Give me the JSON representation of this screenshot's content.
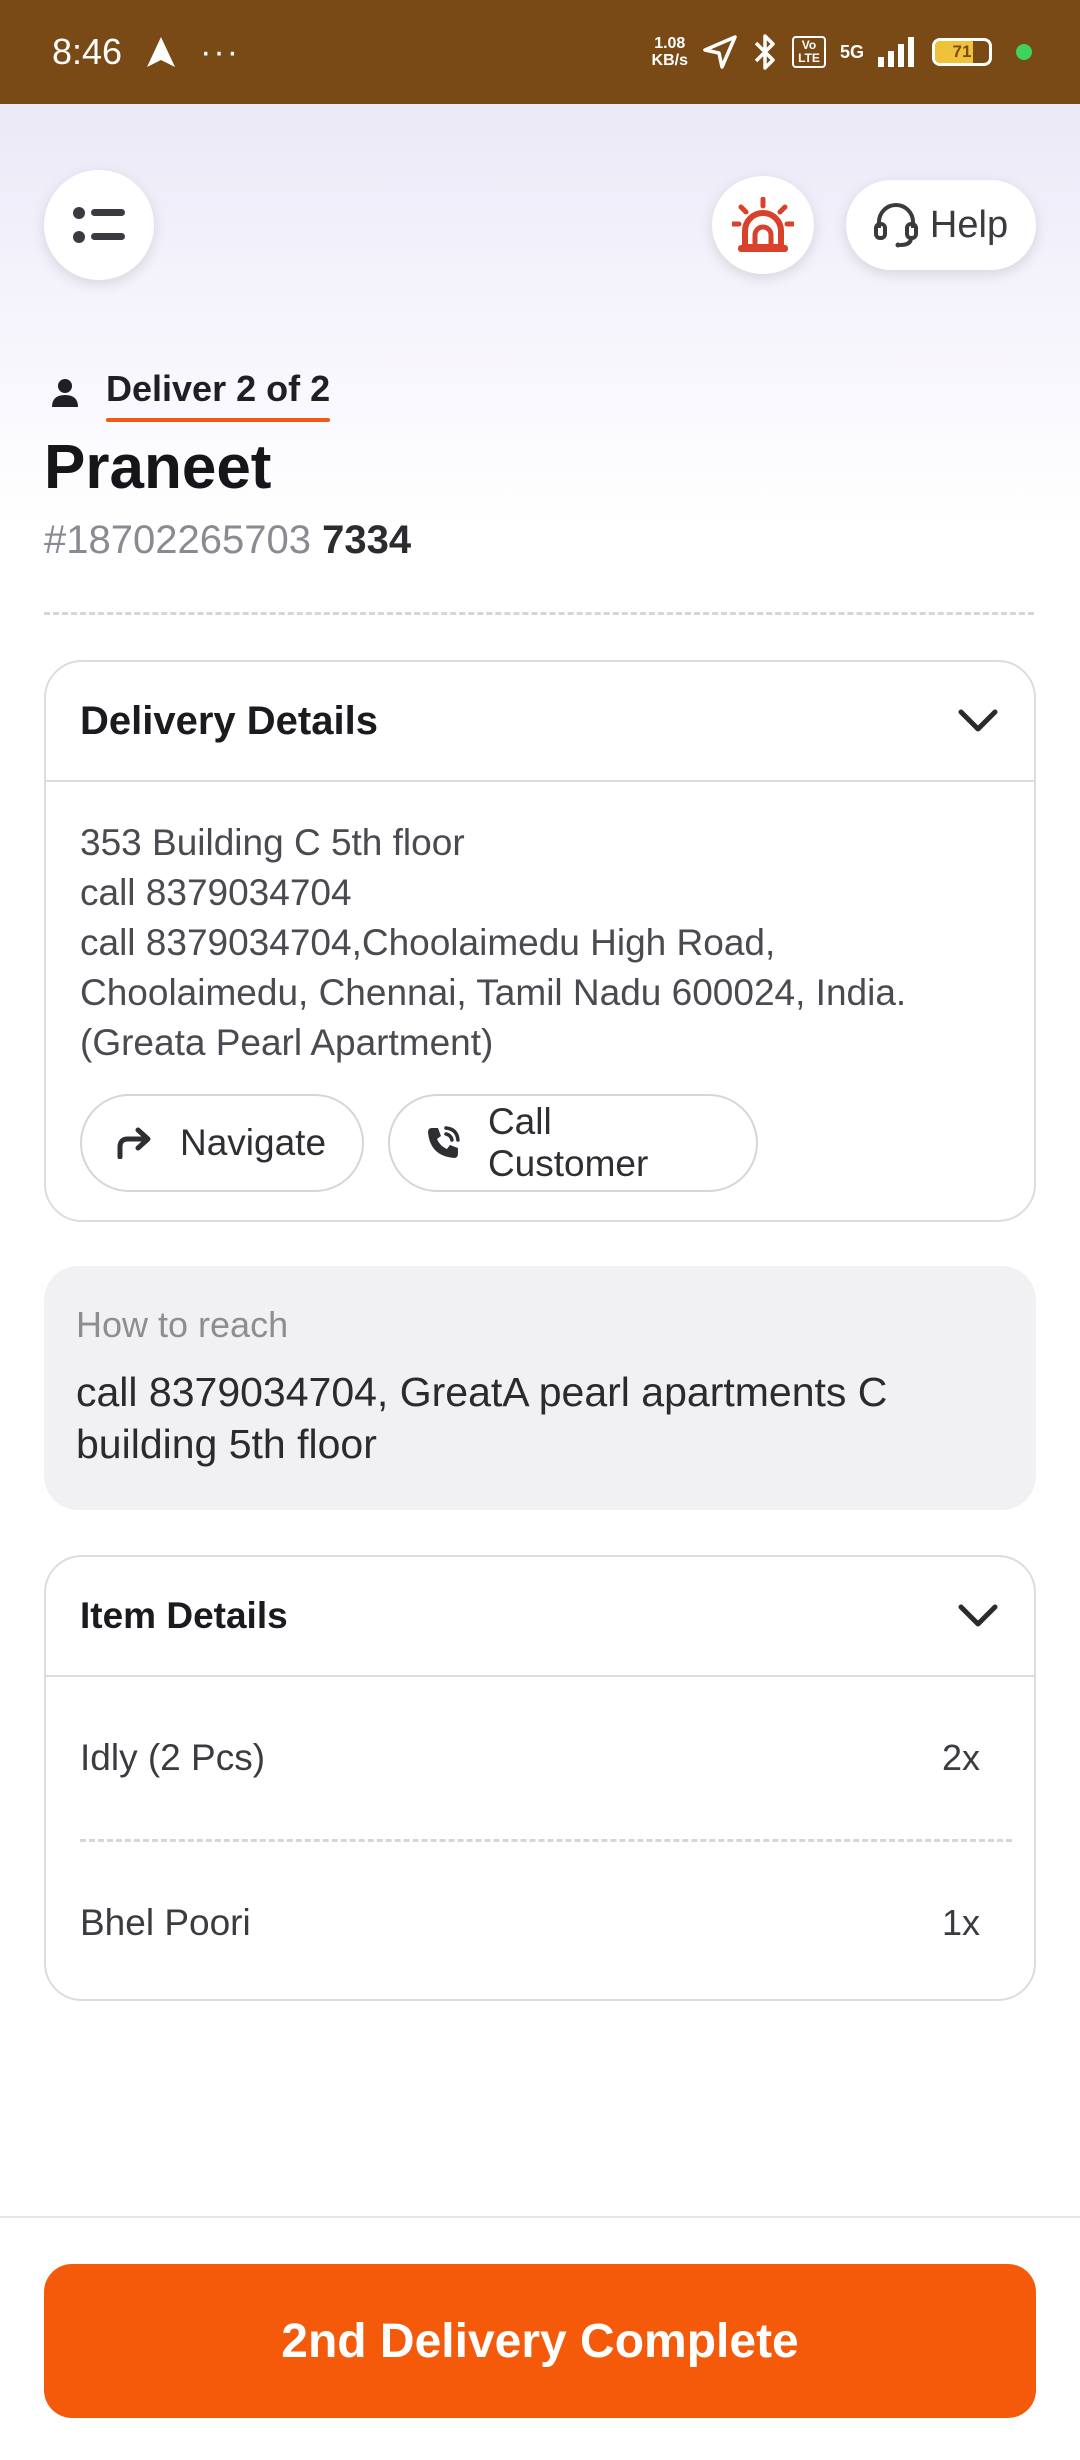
{
  "status_bar": {
    "time": "8:46",
    "more": "···",
    "net_speed_value": "1.08",
    "net_speed_unit": "KB/s",
    "volte": "Vo LTE",
    "network": "5G",
    "battery": "71"
  },
  "header": {
    "help_label": "Help"
  },
  "delivery": {
    "step_label": "Deliver 2 of 2",
    "customer_name": "Praneet",
    "order_id_prefix": "#18702265703",
    "order_id_suffix": "7334"
  },
  "delivery_details": {
    "title": "Delivery Details",
    "address_lines": [
      "353 Building C 5th floor",
      "call 8379034704",
      "call 8379034704,Choolaimedu High Road,",
      "Choolaimedu, Chennai, Tamil Nadu 600024, India.",
      "(Greata Pearl Apartment)"
    ],
    "navigate_label": "Navigate",
    "call_label": "Call Customer"
  },
  "how_to_reach": {
    "label": "How to reach",
    "text": "call 8379034704, GreatA pearl apartments C building 5th floor"
  },
  "item_details": {
    "title": "Item Details",
    "items": [
      {
        "name": "Idly (2 Pcs)",
        "qty": "2x"
      },
      {
        "name": "Bhel Poori",
        "qty": "1x"
      }
    ]
  },
  "footer": {
    "complete_label": "2nd Delivery Complete"
  },
  "colors": {
    "status_bar": "#7a4a16",
    "accent_orange": "#f45a0a",
    "alert_red": "#d9412b"
  }
}
